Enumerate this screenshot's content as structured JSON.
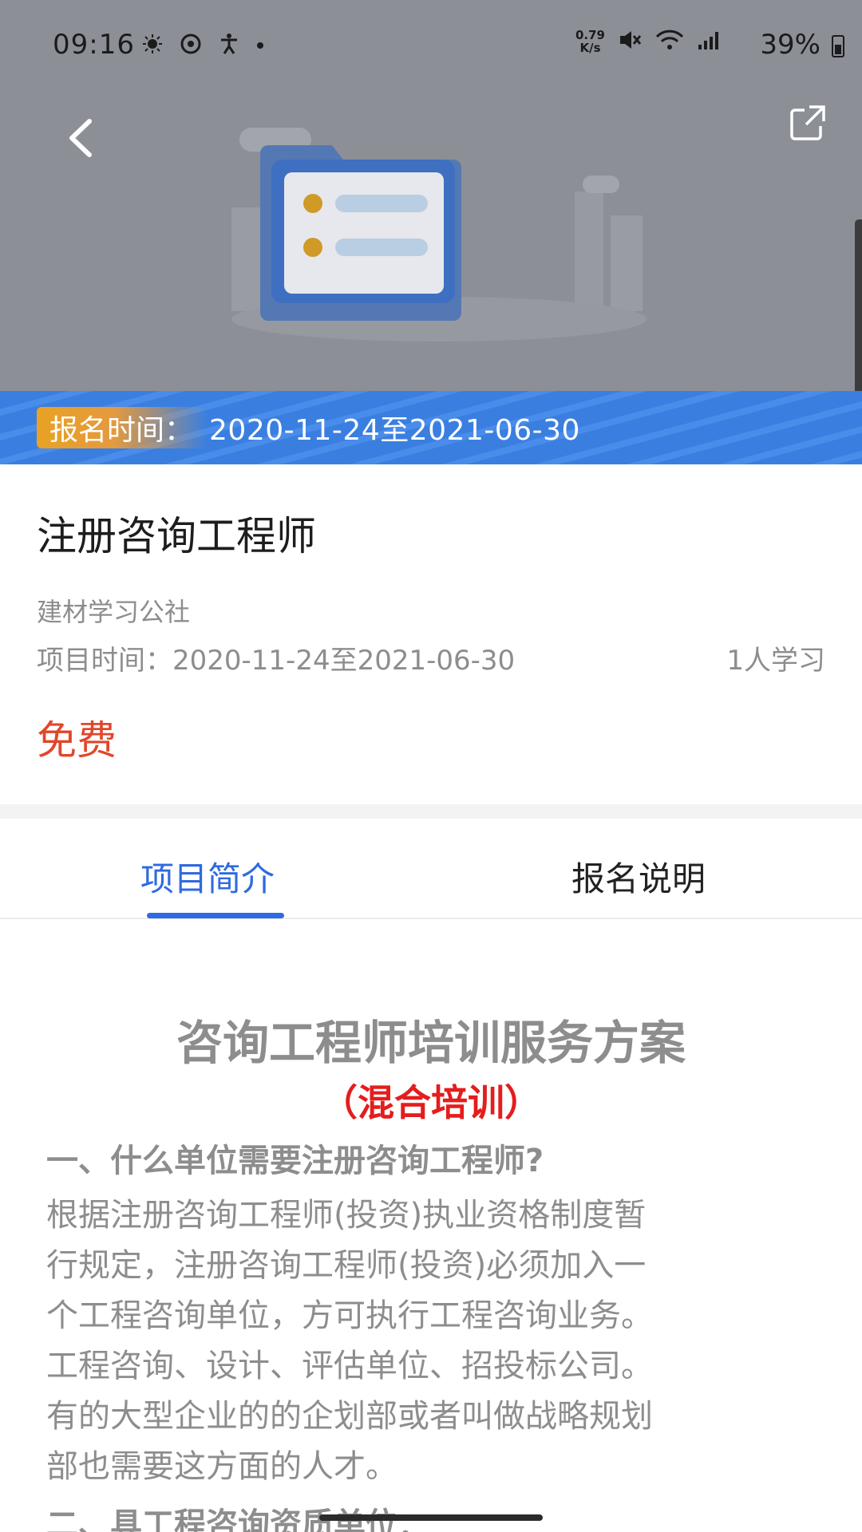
{
  "status_bar": {
    "time": "09:16",
    "net_speed_value": "0.79",
    "net_speed_unit": "K/s",
    "battery": "39%"
  },
  "header": {
    "back_icon": "chevron-left-icon",
    "share_icon": "share-external-icon"
  },
  "registration": {
    "label": "报名时间：",
    "range": "2020-11-24至2021-06-30"
  },
  "project": {
    "title": "注册咨询工程师",
    "organization": "建材学习公社",
    "time_label": "项目时间：",
    "time_range": "2020-11-24至2021-06-30",
    "learners": "1人学习",
    "price": "免费"
  },
  "tabs": [
    {
      "label": "项目简介",
      "active": true
    },
    {
      "label": "报名说明",
      "active": false
    }
  ],
  "content": {
    "title": "咨询工程师培训服务方案",
    "subtitle": "（混合培训）",
    "section1_heading": "一、什么单位需要注册咨询工程师?",
    "section1_lines": [
      "根据注册咨询工程师(投资)执业资格制度暂",
      "行规定，注册咨询工程师(投资)必须加入一",
      "个工程咨询单位，方可执行工程咨询业务。",
      "工程咨询、设计、评估单位、招投标公司。",
      "有的大型企业的的企划部或者叫做战略规划",
      "部也需要这方面的人才。"
    ],
    "section2_heading": "二、具工程咨询资质单位："
  },
  "colors": {
    "accent_blue": "#2f6ae0",
    "price_red": "#e2462a",
    "subtitle_red": "#e41d1d",
    "pill_orange": "#e9a224"
  }
}
